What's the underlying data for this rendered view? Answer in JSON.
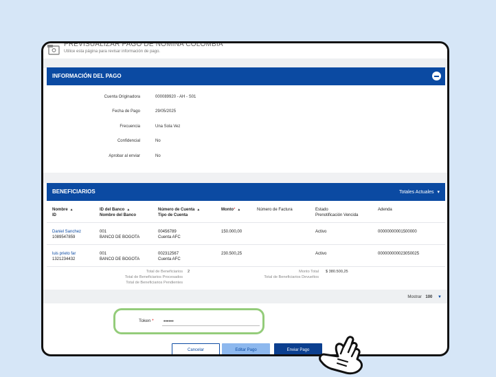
{
  "page": {
    "title": "PREVISUALIZAR PAGO DE NÓMINA COLOMBIA",
    "subtitle": "Utilice esta página para revisar información de pago."
  },
  "info_section": {
    "title": "INFORMACIÓN DEL PAGO",
    "rows": [
      {
        "label": "Cuenta Originadora",
        "value": "000089920 - AH - S01"
      },
      {
        "label": "Fecha de Pago",
        "value": "29/05/2025"
      },
      {
        "label": "Frecuencia",
        "value": "Una Sola Vez"
      },
      {
        "label": "Confidencial",
        "value": "No"
      },
      {
        "label": "Aprobar al enviar",
        "value": "No"
      }
    ]
  },
  "beneficiaries": {
    "title": "BENEFICIARIOS",
    "totals_dropdown": "Totales Actuales",
    "columns": [
      {
        "top": "Nombre",
        "bottom": "ID"
      },
      {
        "top": "ID del Banco",
        "bottom": "Nombre del Banco"
      },
      {
        "top": "Número de Cuenta",
        "bottom": "Tipo de Cuenta"
      },
      {
        "top": "Monto",
        "bottom": ""
      },
      {
        "top": "Número de Factura",
        "bottom": ""
      },
      {
        "top": "Estado",
        "bottom": "Prenotificación Vencida"
      },
      {
        "top": "Adenda",
        "bottom": ""
      }
    ],
    "rows": [
      {
        "name": "Daniel Sanchez",
        "id": "1089547859",
        "bank_id": "001",
        "bank_name": "BANCO DE BOGOTA",
        "account": "00456789",
        "account_type": "Cuenta AFC",
        "amount": "150.000,00",
        "invoice": "",
        "status": "Activo",
        "addenda": "00000000001500000"
      },
      {
        "name": "luis prieto far",
        "id": "1321234432",
        "bank_id": "001",
        "bank_name": "BANCO DE BOGOTA",
        "account": "002312567",
        "account_type": "Cuenta AFC",
        "amount": "230.500,25",
        "invoice": "",
        "status": "Activo",
        "addenda": "000000000023050025"
      }
    ],
    "totals": {
      "total_beneficiaries_label": "Total de Beneficiarios",
      "total_beneficiaries_value": "2",
      "processed_label": "Total de Beneficiarios Procesados",
      "pending_label": "Total de Beneficiarios Pendientes",
      "amount_total_label": "Monto Total",
      "amount_total_value": "$ 380.500,25",
      "returned_label": "Total de Beneficiarios Devueltos"
    },
    "show_label": "Mostrar",
    "show_value": "100"
  },
  "token": {
    "label": "Token",
    "required_mark": "*",
    "value": "••••••"
  },
  "buttons": {
    "cancel": "Cancelar",
    "edit": "Editar Pago",
    "send": "Enviar Pago"
  },
  "colors": {
    "header_blue": "#0b4aa2",
    "highlight_green": "#94cc7a",
    "background": "#d6e6f7"
  }
}
